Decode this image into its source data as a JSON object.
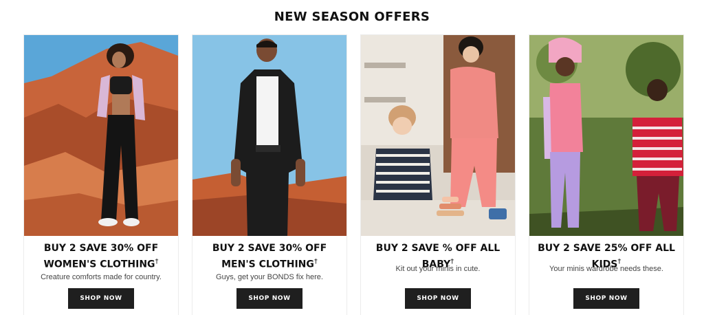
{
  "section": {
    "title": "NEW SEASON OFFERS"
  },
  "cards": [
    {
      "headline": "BUY 2 SAVE 30% OFF WOMEN'S CLOTHING",
      "dagger": "†",
      "subtext": "Creature comforts made for country.",
      "cta": "SHOP NOW"
    },
    {
      "headline": "BUY 2 SAVE 30% OFF MEN'S CLOTHING",
      "dagger": "†",
      "subtext": "Guys, get your BONDS fix here.",
      "cta": "SHOP NOW"
    },
    {
      "headline": "BUY 2 SAVE % OFF ALL BABY",
      "dagger": "†",
      "subtext": "Kit out your minis in cute.",
      "cta": "SHOP NOW"
    },
    {
      "headline": "BUY 2 SAVE 25% OFF ALL KIDS",
      "dagger": "†",
      "subtext": "Your minis wardrobe needs these.",
      "cta": "SHOP NOW"
    }
  ],
  "colors": {
    "button_bg": "#1f1f1f",
    "button_text": "#ffffff",
    "title": "#111111"
  }
}
